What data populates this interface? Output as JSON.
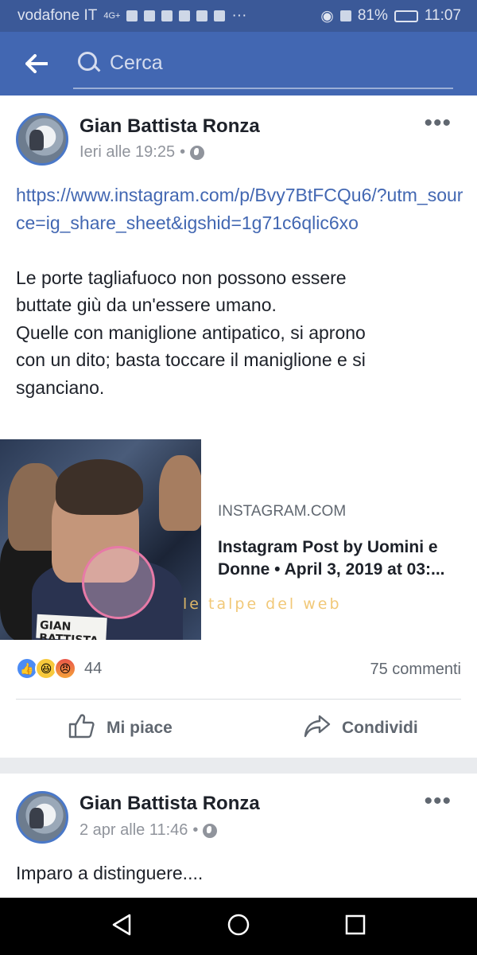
{
  "status_bar": {
    "carrier": "vodafone IT",
    "network": "4G+",
    "battery": "81%",
    "time": "11:07"
  },
  "top_bar": {
    "search_placeholder": "Cerca"
  },
  "post1": {
    "author": "Gian Battista Ronza",
    "time": "Ieri alle 19:25",
    "separator": "•",
    "link_text": "https://www.instagram.com/p/Bvy7BtFCQu6/?utm_source=ig_share_sheet&igshid=1g71c6qlic6xo",
    "body_lines": [
      "Le porte tagliafuoco non possono essere",
      "buttate giù da un'essere umano.",
      "Quelle con maniglione antipatico, si aprono",
      "con un dito; basta toccare il maniglione  e si",
      "sganciano."
    ],
    "card": {
      "domain": "INSTAGRAM.COM",
      "title_line1": "Instagram Post by Uomini e",
      "title_line2": "Donne • April 3, 2019 at 03:...",
      "image_tag": "GIAN BATTISTA",
      "watermark": "le talpe del web"
    },
    "reaction_count": "44",
    "comments": "75 commenti",
    "like_label": "Mi piace",
    "share_label": "Condividi"
  },
  "post2": {
    "author": "Gian Battista Ronza",
    "time": "2 apr alle 11:46",
    "separator": "•",
    "body": "Imparo a distinguere...."
  },
  "colors": {
    "status_bar": "#3b5998",
    "top_bar": "#4267b2",
    "link": "#4267b2",
    "nav_bar": "#000000"
  }
}
